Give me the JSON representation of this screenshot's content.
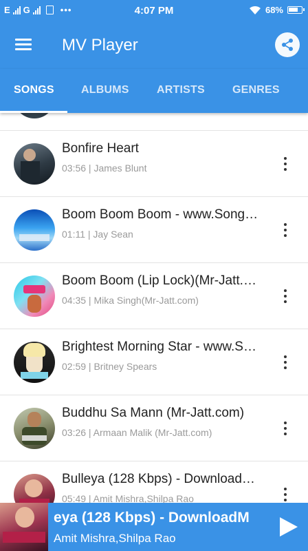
{
  "status_bar": {
    "carrier1": "E",
    "carrier2": "G",
    "time": "4:07 PM",
    "battery": "68%"
  },
  "app": {
    "title": "MV Player"
  },
  "tabs": [
    {
      "label": "SONGS",
      "active": true
    },
    {
      "label": "ALBUMS",
      "active": false
    },
    {
      "label": "ARTISTS",
      "active": false
    },
    {
      "label": "GENRES",
      "active": false
    }
  ],
  "songs": [
    {
      "title": "Bonfire Heart",
      "meta": "03:56 | James Blunt"
    },
    {
      "title": "Boom Boom Boom - www.Song…",
      "meta": "01:11 | Jay Sean"
    },
    {
      "title": "Boom Boom (Lip Lock)(Mr-Jatt.…",
      "meta": "04:35 | Mika Singh(Mr-Jatt.com)"
    },
    {
      "title": "Brightest Morning Star - www.S…",
      "meta": "02:59 | Britney Spears"
    },
    {
      "title": "Buddhu Sa Mann (Mr-Jatt.com)",
      "meta": "03:26 | Armaan Malik (Mr-Jatt.com)"
    },
    {
      "title": "Bulleya (128 Kbps) -  Download…",
      "meta": "05:49 | Amit Mishra,Shilpa Rao"
    }
  ],
  "player": {
    "title": "eya (128 Kbps) -  DownloadM",
    "artist": "Amit Mishra,Shilpa Rao"
  },
  "colors": {
    "primary": "#3a92e6",
    "text": "#222222",
    "meta": "#9a9a9a"
  }
}
